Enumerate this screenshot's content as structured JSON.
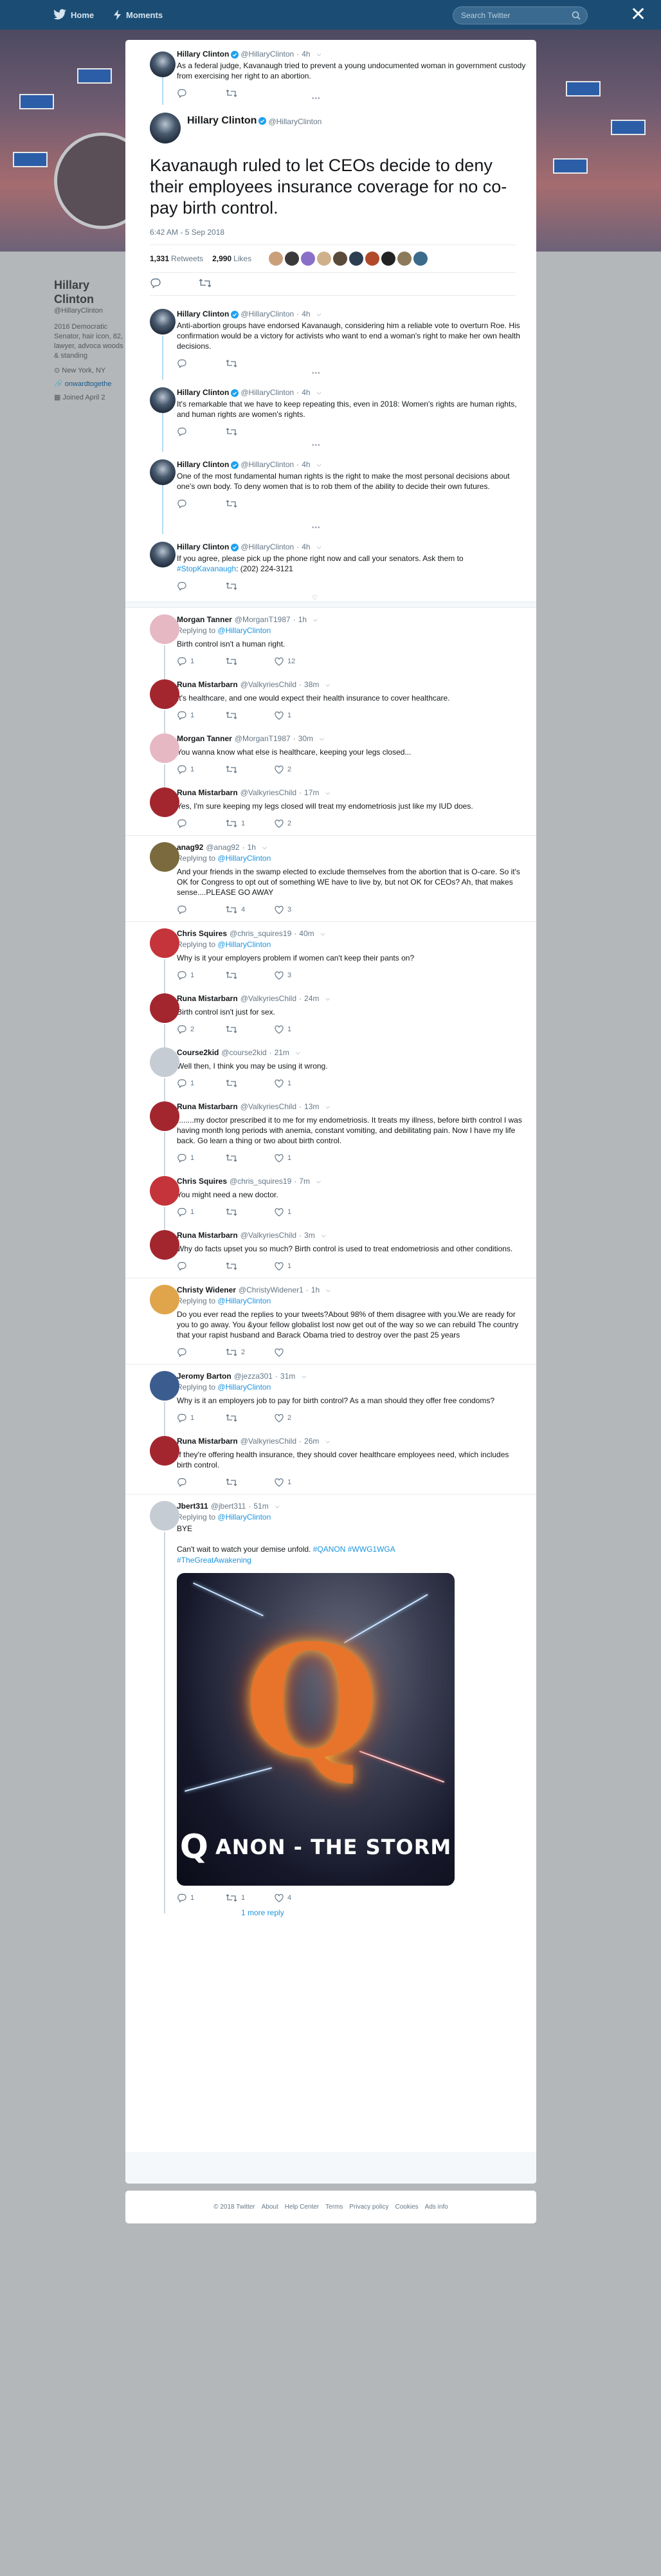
{
  "nav": {
    "home": "Home",
    "moments": "Moments",
    "search_placeholder": "Search Twitter"
  },
  "background_profile": {
    "name": "Hillary Clinton",
    "handle": "@HillaryClinton",
    "bio": "2016 Democratic Senator, hair icon, 82, lawyer, advoca woods & standing",
    "location": "New York, NY",
    "website": "onwardtogethe",
    "joined": "Joined April 2"
  },
  "ancestors": [
    {
      "name": "Hillary Clinton",
      "handle": "@HillaryClinton",
      "time": "4h",
      "text": "As a federal judge, Kavanaugh tried to prevent a young undocumented woman in government custody from exercising her right to an abortion."
    }
  ],
  "main_tweet": {
    "name": "Hillary Clinton",
    "handle": "@HillaryClinton",
    "text": "Kavanaugh ruled to let CEOs decide to deny their employees insurance coverage for no co-pay birth control.",
    "timestamp": "6:42 AM - 5 Sep 2018",
    "retweets": "1,331",
    "retweets_label": "Retweets",
    "likes": "2,990",
    "likes_label": "Likes"
  },
  "thread_continuation": [
    {
      "name": "Hillary Clinton",
      "handle": "@HillaryClinton",
      "time": "4h",
      "text": "Anti-abortion groups have endorsed Kavanaugh, considering him a reliable vote to overturn Roe. His confirmation would be a victory for activists who want to end a woman's right to make her own health decisions."
    },
    {
      "name": "Hillary Clinton",
      "handle": "@HillaryClinton",
      "time": "4h",
      "text": "It's remarkable that we have to keep repeating this, even in 2018: Women's rights are human rights, and human rights are women's rights."
    },
    {
      "name": "Hillary Clinton",
      "handle": "@HillaryClinton",
      "time": "4h",
      "text": "One of the most fundamental human rights is the right to make the most personal decisions about one's own body. To deny women that is to rob them of the ability to decide their own futures."
    },
    {
      "name": "Hillary Clinton",
      "handle": "@HillaryClinton",
      "time": "4h",
      "text_pre": "If you agree, please pick up the phone right now and call your senators. Ask them to ",
      "hashtag": "#StopKavanaugh",
      "text_post": ": (202) 224-3121"
    }
  ],
  "replies": [
    {
      "name": "Morgan Tanner",
      "handle": "@MorganT1987",
      "time": "1h",
      "replying_to": "@HillaryClinton",
      "text": "Birth control isn't a human right.",
      "replies": "1",
      "retweets": "",
      "likes": "12",
      "avatar_color": "#e6b8c3",
      "thread": true
    },
    {
      "name": "Runa Mistarbarn",
      "handle": "@ValkyriesChild",
      "time": "38m",
      "replying_to": "",
      "text": "It's healthcare, and one would expect their health insurance to cover healthcare.",
      "replies": "1",
      "retweets": "",
      "likes": "1",
      "avatar_color": "#a3262f",
      "thread": true
    },
    {
      "name": "Morgan Tanner",
      "handle": "@MorganT1987",
      "time": "30m",
      "replying_to": "",
      "text": "You wanna know what else is healthcare, keeping your legs closed...",
      "replies": "1",
      "retweets": "",
      "likes": "2",
      "avatar_color": "#e6b8c3",
      "thread": true
    },
    {
      "name": "Runa Mistarbarn",
      "handle": "@ValkyriesChild",
      "time": "17m",
      "replying_to": "",
      "text": "Yes, I'm sure keeping my legs closed will treat my endometriosis just like my IUD does.",
      "replies": "",
      "retweets": "1",
      "likes": "2",
      "avatar_color": "#a3262f",
      "thread": false
    },
    {
      "name": "anag92",
      "handle": "@anag92",
      "time": "1h",
      "replying_to": "@HillaryClinton",
      "text": "And your friends in the swamp elected to exclude themselves from the abortion that is O-care.  So it's OK for Congress to opt out of something WE have to live by, but not OK for CEOs?  Ah, that makes sense....PLEASE GO AWAY",
      "replies": "",
      "retweets": "4",
      "likes": "3",
      "avatar_color": "#7a6a3d",
      "thread": false
    },
    {
      "name": "Chris Squires",
      "handle": "@chris_squires19",
      "time": "40m",
      "replying_to": "@HillaryClinton",
      "text": "Why is it your employers problem if women can't keep their pants on?",
      "replies": "1",
      "retweets": "",
      "likes": "3",
      "avatar_color": "#c4343a",
      "thread": true
    },
    {
      "name": "Runa Mistarbarn",
      "handle": "@ValkyriesChild",
      "time": "24m",
      "replying_to": "",
      "text": "Birth control isn't just for sex.",
      "replies": "2",
      "retweets": "",
      "likes": "1",
      "avatar_color": "#a3262f",
      "thread": true
    },
    {
      "name": "Course2kid",
      "handle": "@course2kid",
      "time": "21m",
      "replying_to": "",
      "text": "Well then, I think you may be using it wrong.",
      "replies": "1",
      "retweets": "",
      "likes": "1",
      "avatar_color": "#c5ccd3",
      "thread": true
    },
    {
      "name": "Runa Mistarbarn",
      "handle": "@ValkyriesChild",
      "time": "13m",
      "replying_to": "",
      "text": "........my doctor prescribed it to me for my endometriosis. It treats my illness, before birth control I was having month long periods with anemia, constant vomiting, and debilitating pain. Now I have my life back. Go learn a thing or two about birth control.",
      "replies": "1",
      "retweets": "",
      "likes": "1",
      "avatar_color": "#a3262f",
      "thread": true
    },
    {
      "name": "Chris Squires",
      "handle": "@chris_squires19",
      "time": "7m",
      "replying_to": "",
      "text": "You might need a new doctor.",
      "replies": "1",
      "retweets": "",
      "likes": "1",
      "avatar_color": "#c4343a",
      "thread": true
    },
    {
      "name": "Runa Mistarbarn",
      "handle": "@ValkyriesChild",
      "time": "3m",
      "replying_to": "",
      "text": "Why do facts upset you so much? Birth control is used to treat endometriosis and other conditions.",
      "replies": "",
      "retweets": "",
      "likes": "1",
      "avatar_color": "#a3262f",
      "thread": false
    },
    {
      "name": "Christy Widener",
      "handle": "@ChristyWidener1",
      "time": "1h",
      "replying_to": "@HillaryClinton",
      "text": "Do you ever read the replies to your tweets?About 98% of them disagree with you.We are ready for you to go away. You &your fellow globalist lost now get out of the way so we can rebuild The country that your rapist husband and Barack Obama tried to destroy over the past 25 years",
      "replies": "",
      "retweets": "2",
      "likes": "",
      "avatar_color": "#e0a54a",
      "thread": false
    },
    {
      "name": "Jeromy Barton",
      "handle": "@jezza301",
      "time": "31m",
      "replying_to": "@HillaryClinton",
      "text": "Why is it an employers job to pay for birth control? As a man should they offer free condoms?",
      "replies": "1",
      "retweets": "",
      "likes": "2",
      "avatar_color": "#3b5c8f",
      "thread": true
    },
    {
      "name": "Runa Mistarbarn",
      "handle": "@ValkyriesChild",
      "time": "26m",
      "replying_to": "",
      "text": "If they're offering health insurance, they should cover healthcare employees need, which includes birth control.",
      "replies": "",
      "retweets": "",
      "likes": "1",
      "avatar_color": "#a3262f",
      "thread": false
    }
  ],
  "last_reply": {
    "name": "Jbert311",
    "handle": "@jbert311",
    "time": "51m",
    "replying_to": "@HillaryClinton",
    "text1": "BYE",
    "text2_pre": "Can't wait to watch your demise unfold. ",
    "hashtags_line1": "#QANON #WWG1WGA",
    "hashtags_line2": "#TheGreatAwakening",
    "image_caption_q": "Q",
    "image_caption": "ANON - THE STORM",
    "replies": "1",
    "retweets": "1",
    "likes": "4",
    "more_replies": "1 more reply",
    "avatar_color": "#c5ccd3"
  },
  "labels": {
    "replying_to": "Replying to"
  },
  "footer": [
    "© 2018 Twitter",
    "About",
    "Help Center",
    "Terms",
    "Privacy policy",
    "Cookies",
    "Ads info"
  ],
  "colors": {
    "accent": "#1b95e0",
    "topbar": "#1b4d74",
    "thread_line": "#ccd6dd"
  }
}
